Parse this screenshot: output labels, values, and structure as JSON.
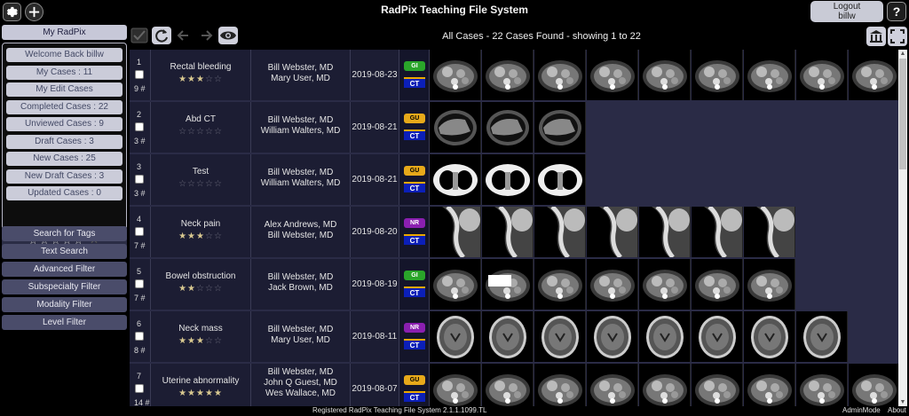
{
  "header": {
    "title": "RadPix Teaching File System",
    "logout_line1": "Logout",
    "logout_line2": "billw",
    "help_label": "?"
  },
  "sidebar": {
    "tab_label": "My RadPix",
    "items": [
      {
        "label": "Welcome Back billw"
      },
      {
        "label": "My Cases : 11"
      },
      {
        "label": "My Edit Cases"
      },
      {
        "label": "Completed Cases : 22"
      },
      {
        "label": "Unviewed Cases : 9"
      },
      {
        "label": "Draft Cases : 3"
      },
      {
        "label": "New Cases : 25"
      },
      {
        "label": "New Draft Cases : 3"
      },
      {
        "label": "Updated Cases : 0"
      }
    ],
    "rating_stars": "☆☆☆☆☆",
    "rating_clear": "✕",
    "filters": [
      {
        "label": "Search for Tags"
      },
      {
        "label": "Text Search"
      },
      {
        "label": "Advanced Filter"
      },
      {
        "label": "Subspecialty Filter"
      },
      {
        "label": "Modality Filter"
      },
      {
        "label": "Level Filter"
      }
    ]
  },
  "results": {
    "title": "All Cases - 22 Cases Found - showing 1 to 22"
  },
  "colors": {
    "gi": "#2aa52a",
    "gu": "#e7a91a",
    "nr": "#8a1fb0",
    "ct": "#0b1fb8"
  },
  "cases": [
    {
      "num": "1",
      "images": "9 #",
      "title": "Rectal bleeding",
      "rating": 3,
      "stars": "★★★☆☆",
      "authors": [
        "Bill Webster, MD",
        "Mary User, MD"
      ],
      "date": "2019-08-23",
      "subspecialty": "GI",
      "sub_color": "#2aa52a",
      "modality": "CT",
      "thumb_count": 9,
      "thumb_kind": "abdomen"
    },
    {
      "num": "2",
      "images": "3 #",
      "title": "Abd CT",
      "rating": 0,
      "stars": "☆☆☆☆☆",
      "authors": [
        "Bill Webster, MD",
        "William Walters, MD"
      ],
      "date": "2019-08-21",
      "subspecialty": "GU",
      "sub_color": "#e7a91a",
      "modality": "CT",
      "thumb_count": 3,
      "thumb_kind": "liver"
    },
    {
      "num": "3",
      "images": "3 #",
      "title": "Test",
      "rating": 0,
      "stars": "☆☆☆☆☆",
      "authors": [
        "Bill Webster, MD",
        "William Walters, MD"
      ],
      "date": "2019-08-21",
      "subspecialty": "GU",
      "sub_color": "#e7a91a",
      "modality": "CT",
      "thumb_count": 3,
      "thumb_kind": "lung"
    },
    {
      "num": "4",
      "images": "7 #",
      "title": "Neck pain",
      "rating": 3,
      "stars": "★★★☆☆",
      "authors": [
        "Alex Andrews, MD",
        "Bill Webster, MD"
      ],
      "date": "2019-08-20",
      "subspecialty": "NR",
      "sub_color": "#8a1fb0",
      "modality": "CT",
      "thumb_count": 7,
      "thumb_kind": "spine"
    },
    {
      "num": "5",
      "images": "7 #",
      "title": "Bowel obstruction",
      "rating": 2,
      "stars": "★★☆☆☆",
      "authors": [
        "Bill Webster, MD",
        "Jack Brown, MD"
      ],
      "date": "2019-08-19",
      "subspecialty": "GI",
      "sub_color": "#2aa52a",
      "modality": "CT",
      "thumb_count": 7,
      "thumb_kind": "abdomen"
    },
    {
      "num": "6",
      "images": "8 #",
      "title": "Neck mass",
      "rating": 3,
      "stars": "★★★☆☆",
      "authors": [
        "Bill Webster, MD",
        "Mary User, MD"
      ],
      "date": "2019-08-11",
      "subspecialty": "NR",
      "sub_color": "#8a1fb0",
      "modality": "CT",
      "thumb_count": 8,
      "thumb_kind": "head"
    },
    {
      "num": "7",
      "images": "14 #",
      "title": "Uterine abnormality",
      "rating": 5,
      "stars": "★★★★★",
      "authors": [
        "Bill Webster, MD",
        "John Q Guest, MD",
        "Wes Wallace, MD"
      ],
      "date": "2019-08-07",
      "subspecialty": "GU",
      "sub_color": "#e7a91a",
      "modality": "CT",
      "thumb_count": 9,
      "thumb_kind": "abdomen"
    }
  ],
  "footer": {
    "center": "Registered RadPix Teaching File System 2.1.1.1099.TL",
    "admin": "AdminMode",
    "about": "About"
  }
}
